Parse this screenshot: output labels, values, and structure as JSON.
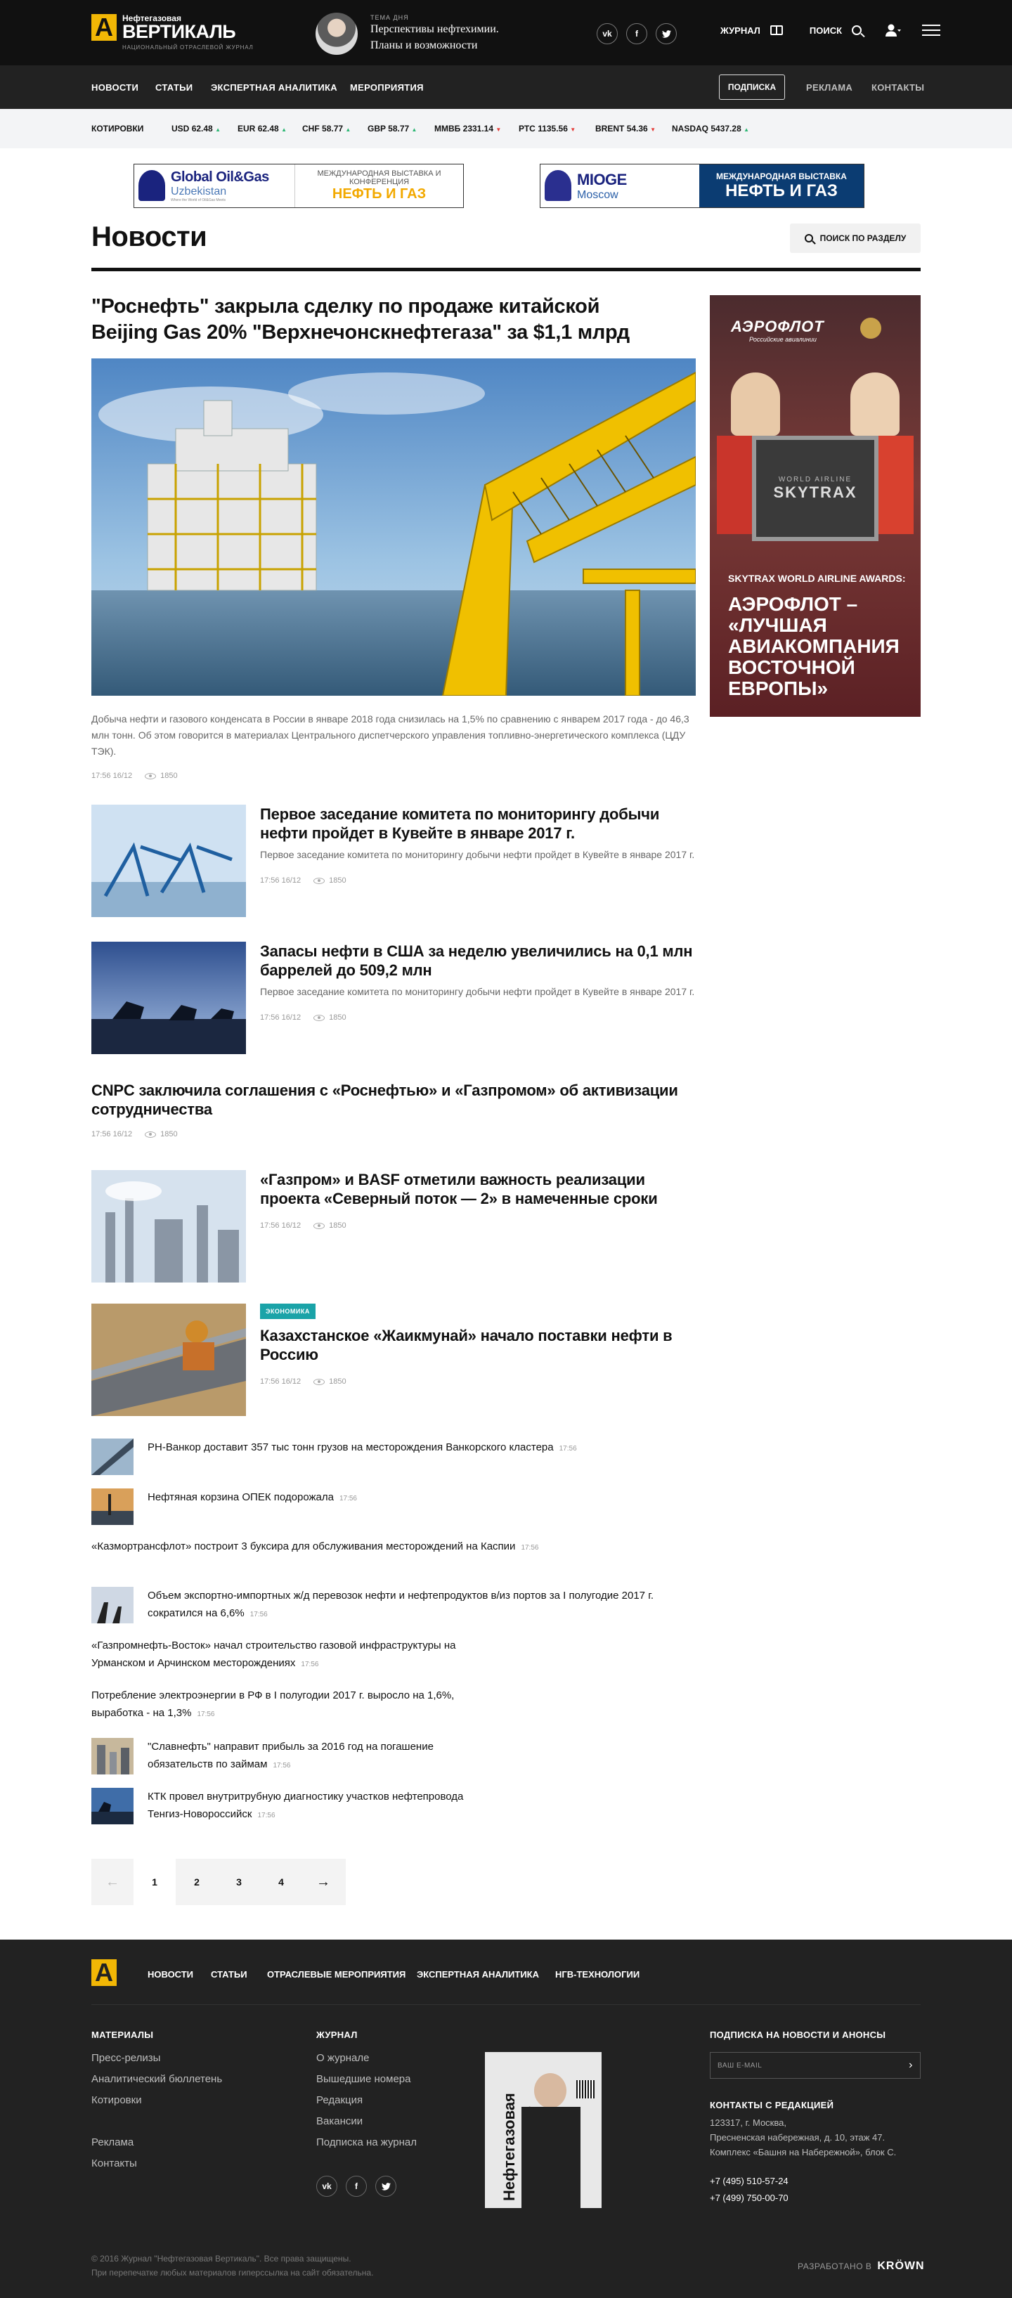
{
  "brand": {
    "line1": "Нефтегазовая",
    "line2": "ВЕРТИКАЛЬ",
    "line3": "НАЦИОНАЛЬНЫЙ ОТРАСЛЕВОЙ ЖУРНАЛ",
    "mark": "A"
  },
  "topic": {
    "kicker": "ТЕМА ДНЯ",
    "title": "Перспективы нефтехимии. Планы и возможности"
  },
  "socials": {
    "vk": "vk",
    "fb": "f",
    "tw": "t"
  },
  "topnav": {
    "journal": "ЖУРНАЛ",
    "search": "ПОИСК"
  },
  "subnav": {
    "items": [
      "НОВОСТИ",
      "СТАТЬИ",
      "ЭКСПЕРТНАЯ АНАЛИТИКА",
      "МЕРОПРИЯТИЯ"
    ],
    "subscribe": "ПОДПИСКА",
    "ads": "РЕКЛАМА",
    "contacts": "КОНТАКТЫ"
  },
  "quotes": {
    "label": "КОТИРОВКИ",
    "items": [
      {
        "name": "USD",
        "value": "62.48",
        "dir": "up"
      },
      {
        "name": "EUR",
        "value": "62.48",
        "dir": "up"
      },
      {
        "name": "CHF",
        "value": "58.77",
        "dir": "up"
      },
      {
        "name": "GBP",
        "value": "58.77",
        "dir": "up"
      },
      {
        "name": "ММВБ",
        "value": "2331.14",
        "dir": "down"
      },
      {
        "name": "РТС",
        "value": "1135.56",
        "dir": "down"
      },
      {
        "name": "BRENT",
        "value": "54.36",
        "dir": "down"
      },
      {
        "name": "NASDAQ",
        "value": "5437.28",
        "dir": "up"
      }
    ]
  },
  "banners": {
    "left": {
      "name": "Global Oil&Gas",
      "sub": "Uzbekistan",
      "tiny": "Where the World of Oil&Gas Meets",
      "right1": "МЕЖДУНАРОДНАЯ ВЫСТАВКА И КОНФЕРЕНЦИЯ",
      "right2": "НЕФТЬ И ГАЗ"
    },
    "right": {
      "name": "MIOGE",
      "sub": "Moscow",
      "right1": "МЕЖДУНАРОДНАЯ ВЫСТАВКА",
      "right2": "НЕФТЬ И ГАЗ"
    }
  },
  "page": {
    "title": "Новости",
    "search_section": "ПОИСК ПО РАЗДЕЛУ"
  },
  "lead": {
    "title": "\"Роснефть\" закрыла сделку по продаже китайской Beijing Gas 20% \"Верхнечонскнефтегаза\" за $1,1 млрд",
    "text": "Добыча нефти и газового конденсата в России в январе 2018 года снизилась на 1,5% по сравнению с январем 2017 года - до 46,3 млн тонн. Об этом говорится в материалах Центрального диспетчерского управления топливно-энергетического комплекса (ЦДУ ТЭК).",
    "time": "17:56 16/12",
    "views": "1850"
  },
  "ad": {
    "brand": "АЭРОФЛОТ",
    "brand_sub": "Российские авиалинии",
    "award": "SKYTRAX WORLD AIRLINE AWARDS:",
    "headline": "АЭРОФЛОТ – «ЛУЧШАЯ АВИАКОМПАНИЯ ВОСТОЧНОЙ ЕВРОПЫ»",
    "plaque": "SKYTRAX",
    "plaque_top": "WORLD AIRLINE"
  },
  "news": [
    {
      "title": "Первое заседание комитета по мониторингу добычи нефти пройдет в Кувейте в январе 2017 г.",
      "text": "Первое заседание комитета по мониторингу добычи нефти пройдет в Кувейте в январе 2017 г.",
      "time": "17:56 16/12",
      "views": "1850"
    },
    {
      "title": "Запасы нефти в США за неделю увеличились на 0,1 млн баррелей до 509,2 млн",
      "text": "Первое заседание комитета по мониторингу добычи нефти пройдет в Кувейте в январе 2017 г.",
      "time": "17:56 16/12",
      "views": "1850"
    },
    {
      "title": "CNPC заключила соглашения с «Роснефтью» и «Газпромом» об активизации сотрудничества",
      "time": "17:56 16/12",
      "views": "1850"
    },
    {
      "title": "«Газпром» и BASF отметили важность реализации проекта «Северный поток — 2» в намеченные сроки",
      "time": "17:56 16/12",
      "views": "1850"
    },
    {
      "tag": "ЭКОНОМИКА",
      "title": "Казахстанское «Жаикмунай» начало поставки нефти в Россию",
      "time": "17:56 16/12",
      "views": "1850"
    }
  ],
  "small_news": [
    {
      "text": "РН-Ванкор доставит 357 тыс тонн грузов на месторождения Ванкорского кластера",
      "time": "17:56"
    },
    {
      "text": "Нефтяная корзина ОПЕК подорожала",
      "time": "17:56"
    },
    {
      "text": "«Казмортрансфлот» построит 3 буксира для обслуживания месторождений на Каспии",
      "time": "17:56"
    },
    {
      "text": "Объем экспортно-импортных ж/д перевозок нефти и нефтепродуктов в/из портов за I полугодие 2017 г. сократился на 6,6%",
      "time": "17:56"
    },
    {
      "text": "«Газпромнефть-Восток» начал строительство газовой инфраструктуры на Урманском и Арчинском месторождениях",
      "time": "17:56"
    },
    {
      "text": "Потребление электроэнергии в РФ в I полугодии 2017 г. выросло на 1,6%, выработка - на 1,3%",
      "time": "17:56"
    },
    {
      "text": "\"Славнефть\" направит прибыль за 2016 год на погашение обязательств по займам",
      "time": "17:56"
    },
    {
      "text": "КТК провел внутритрубную диагностику участков нефтепровода Тенгиз-Новороссийск",
      "time": "17:56"
    }
  ],
  "pagination": {
    "prev": "←",
    "pages": [
      "1",
      "2",
      "3",
      "4"
    ],
    "next": "→",
    "current": "1"
  },
  "footer": {
    "nav": [
      "НОВОСТИ",
      "СТАТЬИ",
      "ОТРАСЛЕВЫЕ МЕРОПРИЯТИЯ",
      "ЭКСПЕРТНАЯ АНАЛИТИКА",
      "НГВ-ТЕХНОЛОГИИ"
    ],
    "materials_head": "МАТЕРИАЛЫ",
    "materials": [
      "Пресс-релизы",
      "Аналитический бюллетень",
      "Котировки"
    ],
    "materials2": [
      "Реклама",
      "Контакты"
    ],
    "journal_head": "ЖУРНАЛ",
    "journal": [
      "О журнале",
      "Вышедшие номера",
      "Редакция",
      "Вакансии",
      "Подписка на журнал"
    ],
    "subscribe_head": "ПОДПИСКА НА НОВОСТИ И АНОНСЫ",
    "email_placeholder": "ВАШ E-MAIL",
    "contacts_head": "КОНТАКТЫ С РЕДАКЦИЕЙ",
    "address": [
      "123317, г. Москва,",
      "Пресненская набережная, д. 10, этаж 47.",
      "Комплекс «Башня на Набережной», блок С."
    ],
    "phones": [
      "+7 (495) 510-57-24",
      "+7 (499) 750-00-70"
    ],
    "cover_title": "Нефтегазовая ВЕРТИКАЛЬ",
    "copyright": [
      "© 2016 Журнал \"Нефтегазовая Вертикаль\". Все права защищены.",
      "При перепечатке любых материалов гиперссылка на сайт обязательна."
    ],
    "made_by": "РАЗРАБОТАНО В",
    "made_brand": "KRÖWN"
  }
}
